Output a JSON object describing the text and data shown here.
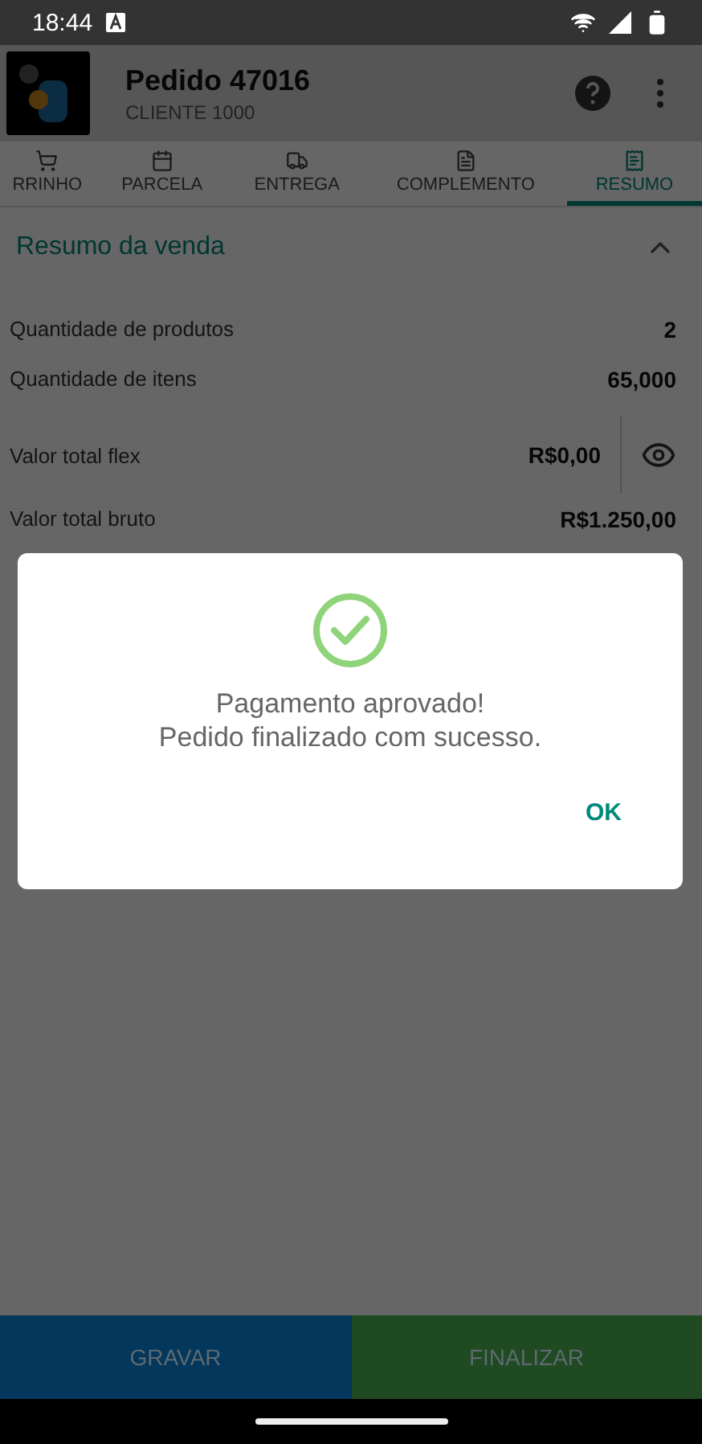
{
  "status_bar": {
    "time": "18:44"
  },
  "app_bar": {
    "title": "Pedido 47016",
    "subtitle": "CLIENTE 1000"
  },
  "tabs": [
    {
      "label": "RRINHO",
      "selected": false
    },
    {
      "label": "PARCELA",
      "selected": false
    },
    {
      "label": "ENTREGA",
      "selected": false
    },
    {
      "label": "COMPLEMENTO",
      "selected": false
    },
    {
      "label": "RESUMO",
      "selected": true
    }
  ],
  "section": {
    "title": "Resumo da venda",
    "expanded": true
  },
  "rows": [
    {
      "kind": "plain",
      "label": "Quantidade de produtos",
      "value": "2"
    },
    {
      "kind": "plain",
      "label": "Quantidade de itens",
      "value": "65,000"
    },
    {
      "kind": "reveal",
      "label": "Valor total flex",
      "value": "R$0,00"
    },
    {
      "kind": "plain",
      "label": "Valor total bruto",
      "value": "R$1.250,00"
    }
  ],
  "buttons": [
    {
      "label": "GRAVAR",
      "color": "#04375c"
    },
    {
      "label": "FINALIZAR",
      "color": "#1f4a22"
    }
  ],
  "dialog": {
    "lines": [
      "Pagamento aprovado!",
      "Pedido finalizado com sucesso."
    ],
    "action": "OK"
  }
}
